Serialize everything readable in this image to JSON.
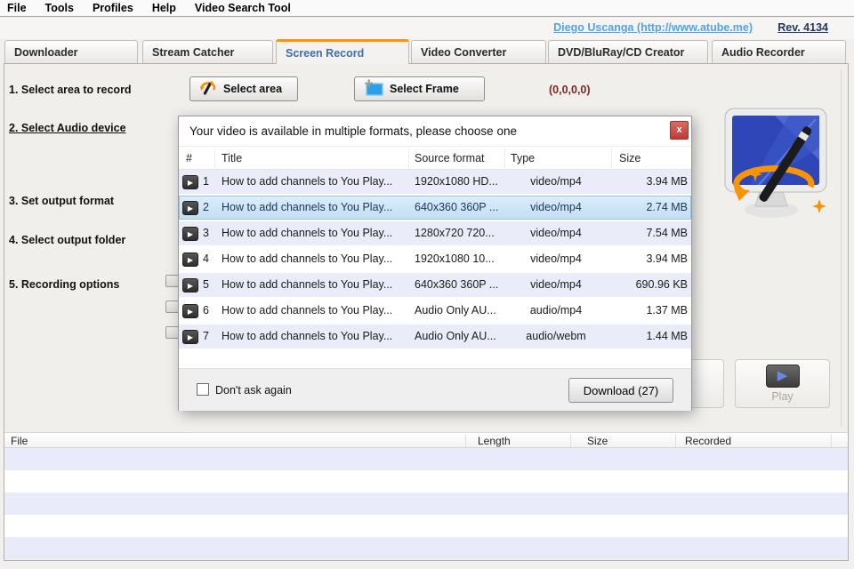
{
  "menu": {
    "items": [
      "File",
      "Tools",
      "Profiles",
      "Help",
      "Video Search Tool"
    ]
  },
  "header": {
    "author_link": "Diego Uscanga (http://www.atube.me)",
    "revision": "Rev. 4134"
  },
  "tabs": [
    {
      "label": "Downloader",
      "active": false
    },
    {
      "label": "Stream Catcher",
      "active": false
    },
    {
      "label": "Screen Record",
      "active": true
    },
    {
      "label": "Video Converter",
      "active": false
    },
    {
      "label": "DVD/BluRay/CD Creator",
      "active": false
    },
    {
      "label": "Audio Recorder",
      "active": false
    }
  ],
  "sidebar": {
    "steps": [
      "1. Select area to record",
      "2. Select Audio device",
      "3. Set output format",
      "4. Select output folder",
      "5. Recording options"
    ]
  },
  "toolbar": {
    "select_area_label": "Select area",
    "select_frame_label": "Select Frame",
    "coords": "(0,0,0,0)"
  },
  "dialog": {
    "title": "Your video is available in multiple formats, please choose one",
    "close_label": "x",
    "columns": [
      "#",
      "Title",
      "Source format",
      "Type",
      "Size"
    ],
    "rows": [
      {
        "num": "1",
        "title": "How to add channels to You Play...",
        "source": "1920x1080 HD...",
        "type": "video/mp4",
        "size": "3.94 MB"
      },
      {
        "num": "2",
        "title": "How to add channels to You Play...",
        "source": "640x360 360P ...",
        "type": "video/mp4",
        "size": "2.74 MB"
      },
      {
        "num": "3",
        "title": "How to add channels to You Play...",
        "source": "1280x720 720...",
        "type": "video/mp4",
        "size": "7.54 MB"
      },
      {
        "num": "4",
        "title": "How to add channels to You Play...",
        "source": "1920x1080 10...",
        "type": "video/mp4",
        "size": "3.94 MB"
      },
      {
        "num": "5",
        "title": "How to add channels to You Play...",
        "source": "640x360 360P ...",
        "type": "video/mp4",
        "size": "690.96 KB"
      },
      {
        "num": "6",
        "title": "How to add channels to You Play...",
        "source": "Audio Only  AU...",
        "type": "audio/mp4",
        "size": "1.37 MB"
      },
      {
        "num": "7",
        "title": "How to add channels to You Play...",
        "source": "Audio Only  AU...",
        "type": "audio/webm",
        "size": "1.44 MB"
      }
    ],
    "selected_row_index": 1,
    "dont_ask_label": "Don't ask again",
    "download_label": "Download (27)"
  },
  "actions": {
    "play_label": "Play"
  },
  "file_table": {
    "columns": [
      "File",
      "Length",
      "Size",
      "Recorded"
    ]
  },
  "icons": {
    "row_play_glyph": "▶",
    "play_button_glyph": "▶"
  },
  "colors": {
    "tab_active_accent": "#ff9400",
    "link_blue": "#4da3f0",
    "revision_navy": "#1f3864",
    "selected_row_blue": "#c3ddf2",
    "close_red": "#bc3c34",
    "coords_maroon": "#7c2622"
  }
}
